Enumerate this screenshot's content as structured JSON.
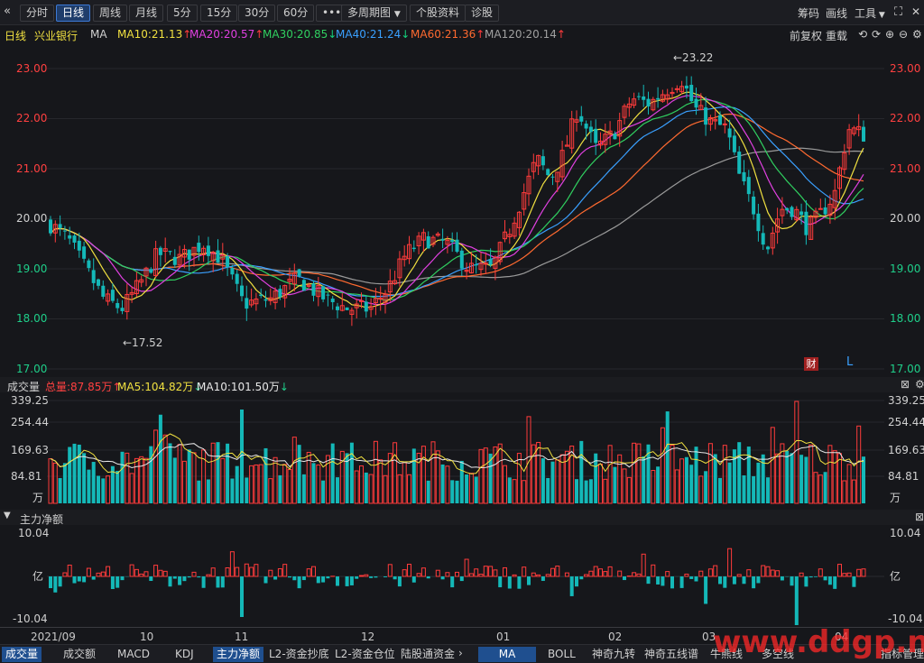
{
  "toolbar": {
    "back_icon": "chevron-left-icon",
    "periods": [
      "分时",
      "日线",
      "周线",
      "月线",
      "5分",
      "15分",
      "30分",
      "60分"
    ],
    "active_period": "日线",
    "more": "•••",
    "multi_period": "多周期图",
    "stock_info": "个股资料",
    "diagnose": "诊股",
    "right": {
      "chips": "筹码",
      "draw": "画线",
      "tools": "工具"
    }
  },
  "ma_bar": {
    "period": "日线",
    "name": "兴业银行",
    "ma_label": "MA",
    "items": [
      {
        "text": "MA10:21.13",
        "arrow": "↑",
        "color": "#f0e040"
      },
      {
        "text": "MA20:20.57",
        "arrow": "↑",
        "color": "#e040e0"
      },
      {
        "text": "MA30:20.85",
        "arrow": "↓",
        "color": "#30d060"
      },
      {
        "text": "MA40:21.24",
        "arrow": "↓",
        "color": "#3aa0ff"
      },
      {
        "text": "MA60:21.36",
        "arrow": "↑",
        "color": "#ff6a30"
      },
      {
        "text": "MA120:20.14",
        "arrow": "↑",
        "color": "#a0a0a0"
      }
    ],
    "right": {
      "adjust": "前复权",
      "overlay": "重载"
    }
  },
  "price_axis": [
    "23.00",
    "22.00",
    "21.00",
    "20.00",
    "19.00",
    "18.00",
    "17.00"
  ],
  "annotations": {
    "high": "←23.22",
    "low": "←17.52",
    "fin_badge": "财",
    "l_badge": "L"
  },
  "volume_panel": {
    "title": "成交量",
    "total": "总量:87.85万",
    "total_arrow": "↑",
    "ma5": "MA5:104.82万",
    "ma5_arrow": "↓",
    "ma10": "MA10:101.50万",
    "ma10_arrow": "↓",
    "axis": [
      "339.25",
      "254.44",
      "169.63",
      "84.81"
    ],
    "unit": "万"
  },
  "flow_panel": {
    "title": "主力净额",
    "axis_top": "10.04",
    "unit": "亿",
    "axis_bottom": "-10.04"
  },
  "date_axis": [
    "2021/09",
    "10",
    "11",
    "12",
    "01",
    "02",
    "03",
    "04"
  ],
  "bottom_tabs_left": [
    "成交量",
    "成交额",
    "MACD",
    "KDJ",
    "主力净额",
    "L2-资金抄底",
    "L2-资金仓位",
    "陆股通资金"
  ],
  "bottom_tabs_right": [
    "MA",
    "BOLL",
    "神奇九转",
    "神奇五线谱",
    "牛熊线",
    "多空线"
  ],
  "bottom_right": "指标管理",
  "watermark": "www.ddgp.net",
  "colors": {
    "up": "#ff3b3b",
    "down": "#14b8b8",
    "bg": "#16171b"
  }
}
